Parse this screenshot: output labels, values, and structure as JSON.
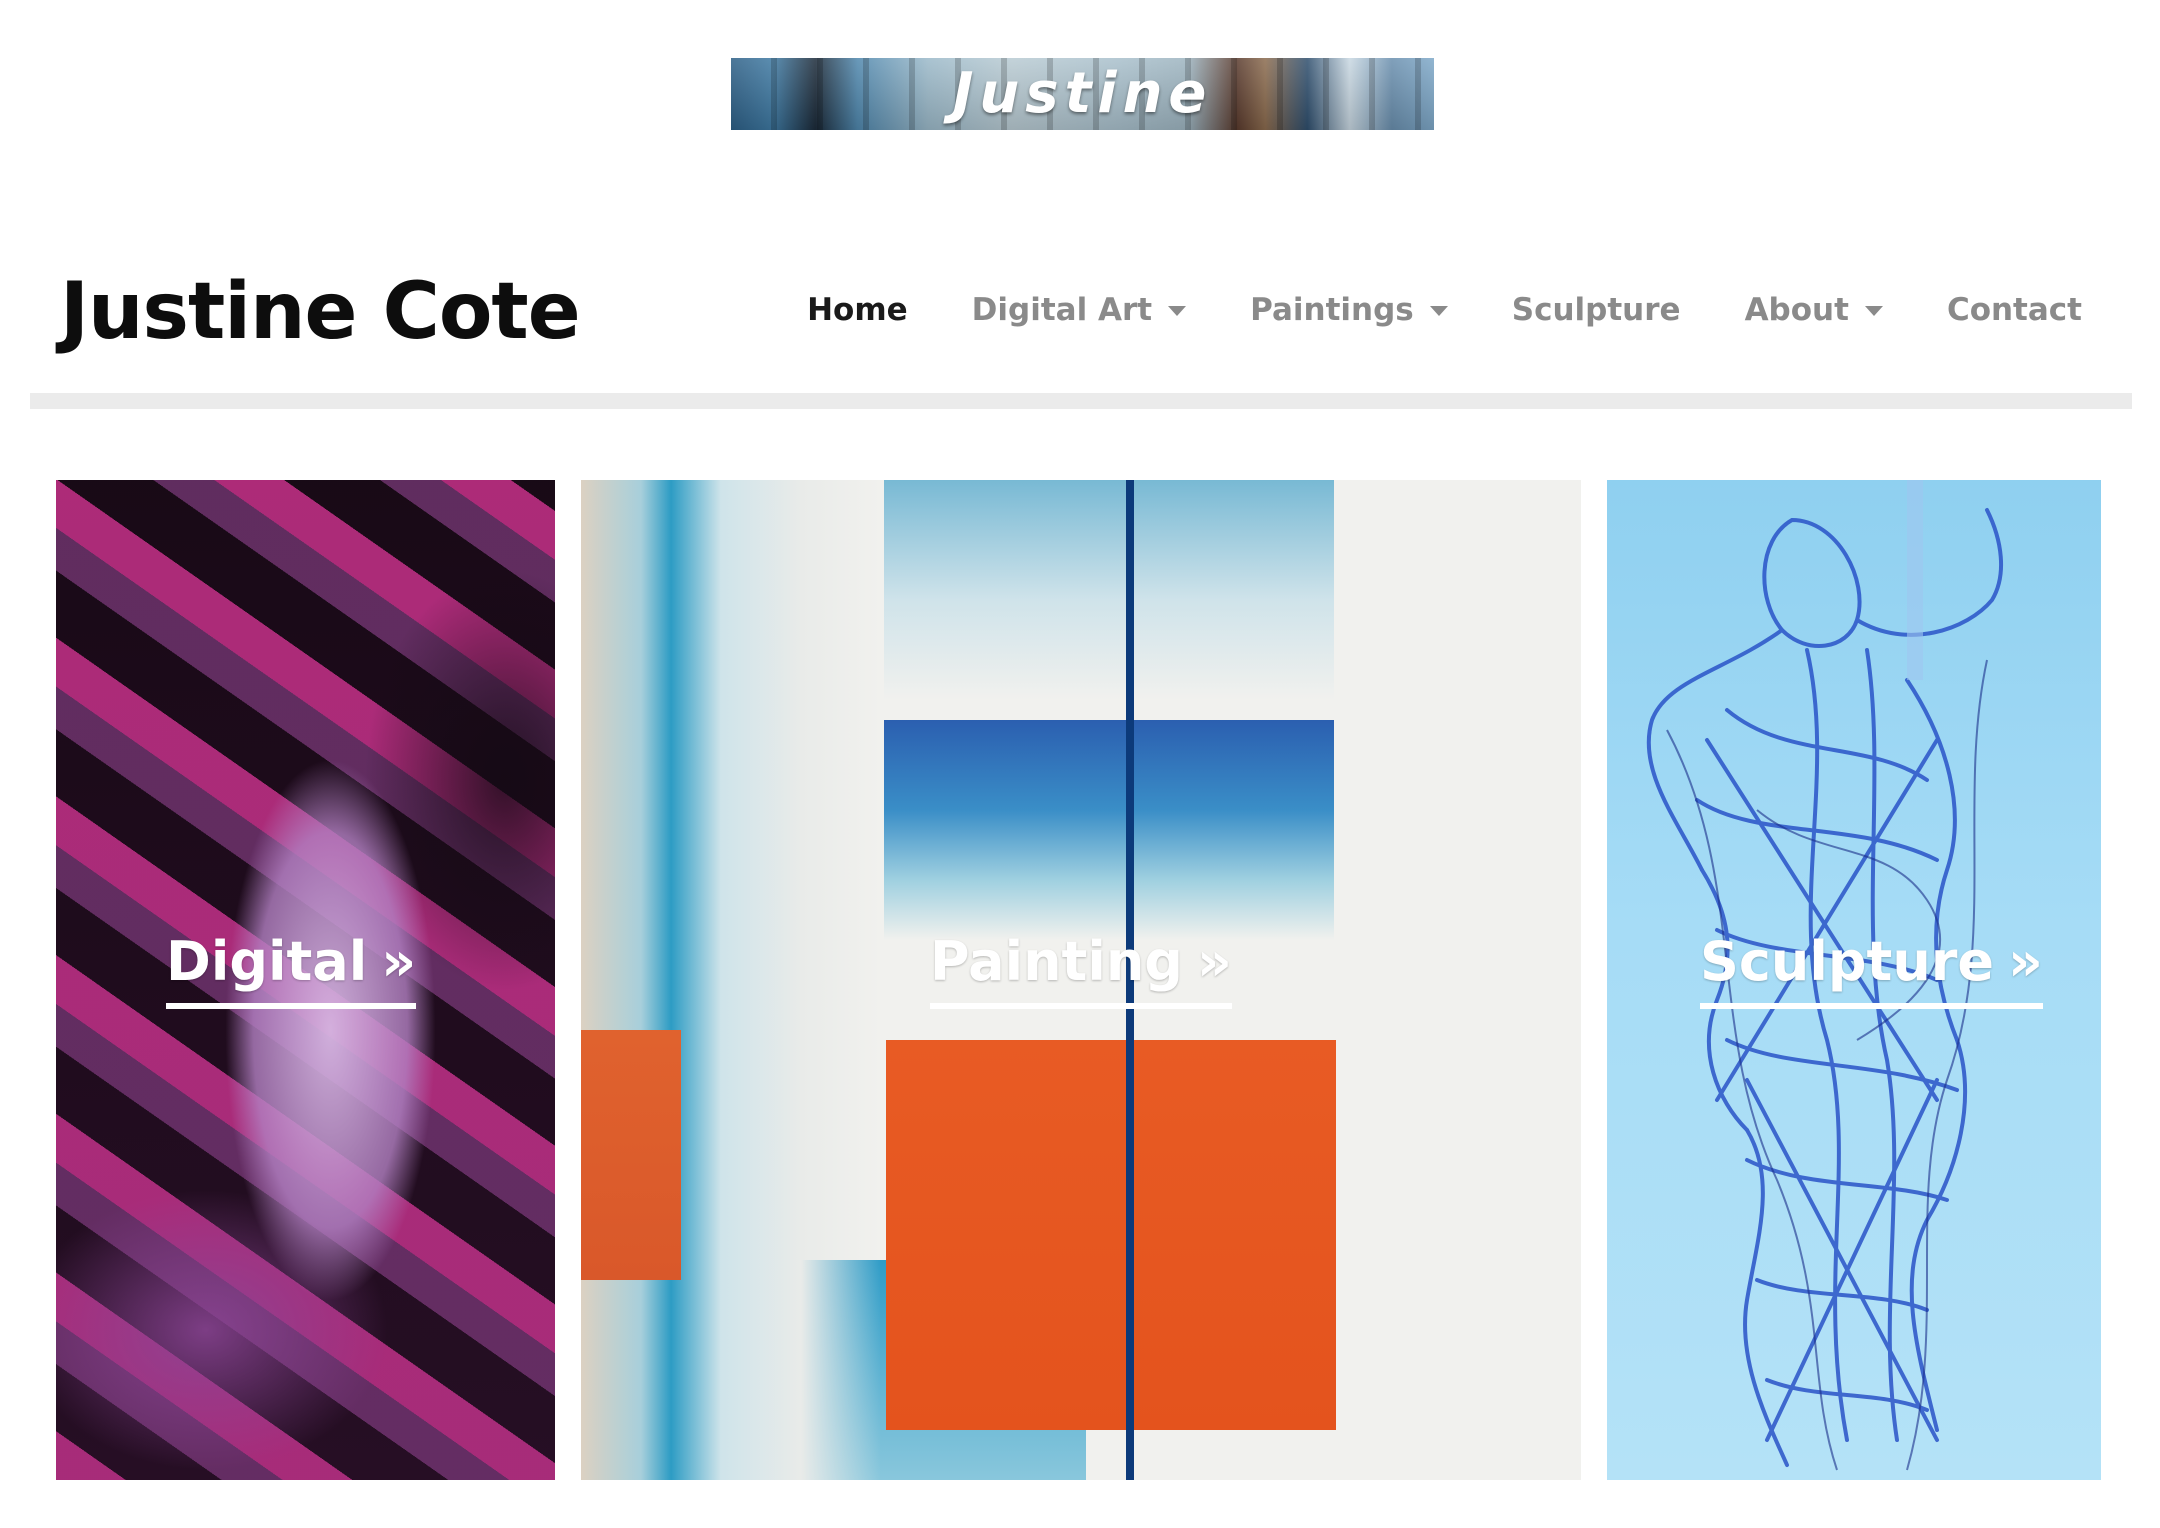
{
  "banner": {
    "logo_text": "Justine"
  },
  "header": {
    "site_title": "Justine Cote"
  },
  "nav": {
    "items": [
      {
        "label": "Home",
        "active": true,
        "dropdown": false
      },
      {
        "label": "Digital Art",
        "active": false,
        "dropdown": true
      },
      {
        "label": "Paintings",
        "active": false,
        "dropdown": true
      },
      {
        "label": "Sculpture",
        "active": false,
        "dropdown": false
      },
      {
        "label": "About",
        "active": false,
        "dropdown": true
      },
      {
        "label": "Contact",
        "active": false,
        "dropdown": false
      }
    ]
  },
  "gallery": {
    "cards": [
      {
        "label": "Digital",
        "icon": "double-chevron-right-icon"
      },
      {
        "label": "Painting",
        "icon": "double-chevron-right-icon"
      },
      {
        "label": "Sculpture",
        "icon": "double-chevron-right-icon"
      }
    ]
  },
  "colors": {
    "nav_active": "#1a1a1a",
    "nav_inactive": "#8a8a8a",
    "header_rule": "#ebebeb",
    "card_label": "#ffffff"
  }
}
